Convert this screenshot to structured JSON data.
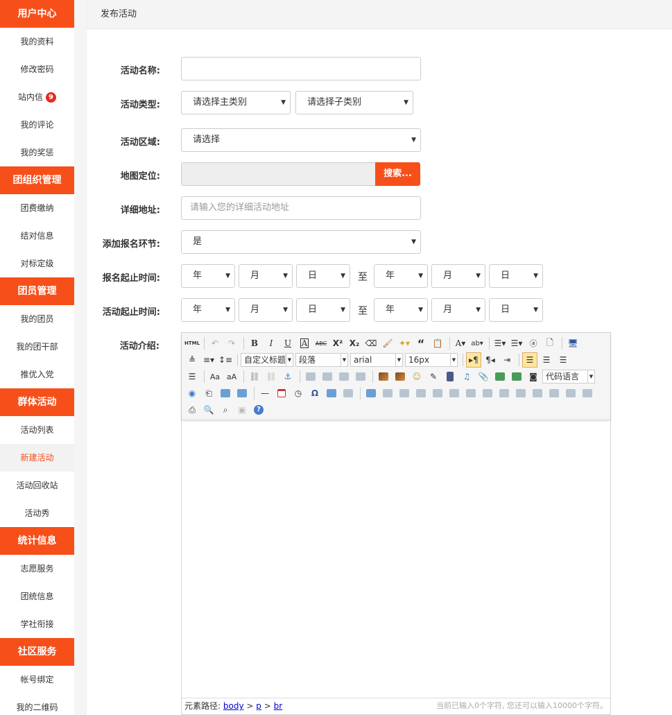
{
  "sidebar": {
    "sections": [
      {
        "title": "用户中心",
        "items": [
          {
            "label": "我的资料"
          },
          {
            "label": "修改密码"
          },
          {
            "label": "站内信",
            "badge": "9"
          },
          {
            "label": "我的评论"
          },
          {
            "label": "我的奖惩"
          }
        ]
      },
      {
        "title": "团组织管理",
        "items": [
          {
            "label": "团费缴纳"
          },
          {
            "label": "结对信息"
          },
          {
            "label": "对标定级"
          }
        ]
      },
      {
        "title": "团员管理",
        "items": [
          {
            "label": "我的团员"
          },
          {
            "label": "我的团干部"
          },
          {
            "label": "推优入党"
          }
        ]
      },
      {
        "title": "群体活动",
        "items": [
          {
            "label": "活动列表"
          },
          {
            "label": "新建活动",
            "active": true
          },
          {
            "label": "活动回收站"
          },
          {
            "label": "活动秀"
          }
        ]
      },
      {
        "title": "统计信息",
        "items": [
          {
            "label": "志愿服务"
          },
          {
            "label": "团统信息"
          },
          {
            "label": "学社衔接"
          }
        ]
      },
      {
        "title": "社区服务",
        "items": [
          {
            "label": "帐号绑定"
          },
          {
            "label": "我的二维码"
          }
        ]
      }
    ]
  },
  "header": {
    "title": "发布活动"
  },
  "form": {
    "name_label": "活动名称:",
    "name_value": "",
    "type_label": "活动类型:",
    "type_main": "请选择主类别",
    "type_sub": "请选择子类别",
    "area_label": "活动区域:",
    "area_value": "请选择",
    "map_label": "地图定位:",
    "map_search": "搜索...",
    "address_label": "详细地址:",
    "address_placeholder": "请输入您的详细活动地址",
    "signup_label": "添加报名环节:",
    "signup_value": "是",
    "signup_time_label": "报名起止时间:",
    "activity_time_label": "活动起止时间:",
    "year": "年",
    "month": "月",
    "day": "日",
    "to": "至",
    "intro_label": "活动介绍:"
  },
  "editor": {
    "combo_title": "自定义标题",
    "combo_paragraph": "段落",
    "combo_font": "arial",
    "combo_size": "16px",
    "combo_code": "代码语言",
    "status_path_label": "元素路径:",
    "path_body": "body",
    "path_p": "p",
    "path_br": "br",
    "path_sep": ">",
    "status_count": "当前已输入0个字符, 您还可以输入10000个字符。"
  },
  "colors": {
    "accent": "#f74f1a",
    "badge": "#e52b20"
  }
}
